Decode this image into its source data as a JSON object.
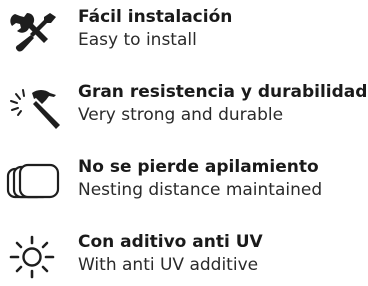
{
  "features": [
    {
      "icon": "tools-icon",
      "title": "Fácil instalación",
      "subtitle": "Easy to install"
    },
    {
      "icon": "hammer-icon",
      "title": "Gran resistencia y durabilidad",
      "subtitle": "Very strong and durable"
    },
    {
      "icon": "stacked-trays-icon",
      "title": "No se pierde apilamiento",
      "subtitle": "Nesting distance maintained"
    },
    {
      "icon": "sun-icon",
      "title": "Con aditivo anti UV",
      "subtitle": "With anti UV additive"
    }
  ],
  "colors": {
    "icon": "#1e1e1e",
    "text": "#1f1f1f"
  }
}
